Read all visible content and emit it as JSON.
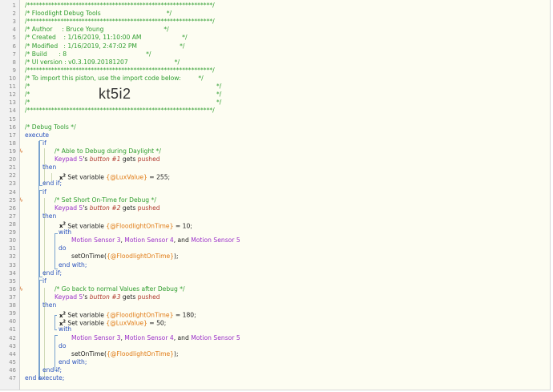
{
  "header": {
    "stars": "/*************************************************************/",
    "title": "/* Floodlight Debug Tools                                  */",
    "author": "/* Author     : Bruce Young                               */",
    "created": "/* Created    : 1/16/2019, 11:10:00 AM                     */",
    "modified": "/* Modified   : 1/16/2019, 2:47:02 PM                      */",
    "build": "/* Build      : 8                                         */",
    "ui_version": "/* UI version : v0.3.109.20181207                        */",
    "import_text": "/* To import this piston, use the import code below:         */",
    "blank_l": "/*",
    "blank_r": "*/",
    "import_code": "kt5i2"
  },
  "lines": {
    "l16": "/* Debug Tools */",
    "l17": "execute",
    "l18": "if",
    "l19": "/* Able to Debug during Daylight */",
    "l20_dev": "Keypad 5",
    "l20_mid": "'s ",
    "l20_btn": "button #1",
    "l20_end": " gets ",
    "l20_val": "pushed",
    "l21": "then",
    "l22_pre": "Set variable ",
    "l22_var": "{@LuxValue}",
    "l22_end": " = 255;",
    "l23": "end if;",
    "l24": "if",
    "l25": "/* Set Short On-Time for Debug */",
    "l26_dev": "Keypad 5",
    "l26_mid": "'s ",
    "l26_btn": "button #2",
    "l26_end": " gets ",
    "l26_val": "pushed",
    "l27": "then",
    "l28_pre": "Set variable ",
    "l28_var": "{@FloodlightOnTime}",
    "l28_end": " = 10;",
    "l29": "with",
    "l30_a": "Motion Sensor 3",
    "l30_b": "Motion Sensor 4",
    "l30_c": "Motion Sensor 5",
    "l30_sep1": ", ",
    "l30_sep2": ", and ",
    "l31": "do",
    "l32_pre": "setOnTime(",
    "l32_var": "{@FloodlightOnTime}",
    "l32_end": ");",
    "l33": "end with;",
    "l34": "end if;",
    "l35": "if",
    "l36": "/* Go back to normal Values after Debug */",
    "l37_dev": "Keypad 5",
    "l37_mid": "'s ",
    "l37_btn": "button #3",
    "l37_end": " gets ",
    "l37_val": "pushed",
    "l38": "then",
    "l39_pre": "Set variable ",
    "l39_var": "{@FloodlightOnTime}",
    "l39_end": " = 180;",
    "l40_pre": "Set variable ",
    "l40_var": "{@LuxValue}",
    "l40_end": " = 50;",
    "l41": "with",
    "l42_a": "Motion Sensor 3",
    "l42_b": "Motion Sensor 4",
    "l42_c": "Motion Sensor 5",
    "l42_sep1": ", ",
    "l42_sep2": ", and ",
    "l43": "do",
    "l44_pre": "setOnTime(",
    "l44_var": "{@FloodlightOnTime}",
    "l44_end": ");",
    "l45": "end with;",
    "l46": "end if;",
    "l47": "end execute;"
  },
  "icons": {
    "task_icon": "x-squared-icon",
    "condition_flag": "lightning-flag-icon"
  },
  "task_icon_text": "x",
  "task_icon_sup": "2",
  "flag_glyph": "ϟ",
  "line_numbers": [
    "1",
    "2",
    "3",
    "4",
    "5",
    "6",
    "7",
    "8",
    "9",
    "10",
    "11",
    "12",
    "13",
    "14",
    "15",
    "16",
    "17",
    "18",
    "19",
    "20",
    "21",
    "22",
    "23",
    "24",
    "25",
    "26",
    "27",
    "28",
    "29",
    "30",
    "31",
    "32",
    "33",
    "34",
    "35",
    "36",
    "37",
    "38",
    "39",
    "40",
    "41",
    "42",
    "43",
    "44",
    "45",
    "46",
    "47"
  ],
  "colors": {
    "comment": "#2f9d2f",
    "keyword": "#2a52be",
    "device": "#9b30c9",
    "variable": "#e07a14",
    "gutter": "#f1f1f1"
  }
}
